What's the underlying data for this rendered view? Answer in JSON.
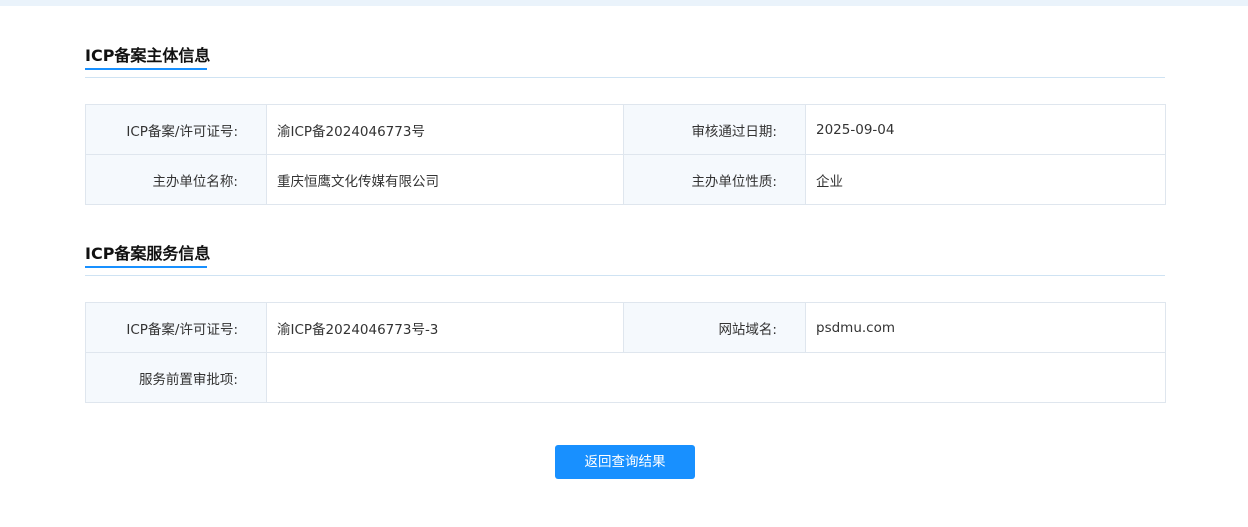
{
  "subject_section": {
    "title": "ICP备案主体信息",
    "rows": [
      {
        "label1": "ICP备案/许可证号:",
        "value1": "渝ICP备2024046773号",
        "label2": "审核通过日期:",
        "value2": "2025-09-04"
      },
      {
        "label1": "主办单位名称:",
        "value1": "重庆恒鹰文化传媒有限公司",
        "label2": "主办单位性质:",
        "value2": "企业"
      }
    ]
  },
  "service_section": {
    "title": "ICP备案服务信息",
    "rows": [
      {
        "label1": "ICP备案/许可证号:",
        "value1": "渝ICP备2024046773号-3",
        "label2": "网站域名:",
        "value2": "psdmu.com"
      },
      {
        "label1": "服务前置审批项:",
        "value1": ""
      }
    ]
  },
  "actions": {
    "back_label": "返回查询结果"
  },
  "colors": {
    "accent": "#1890ff",
    "label_bg": "#f5f9fd",
    "border": "#dfe6ee",
    "top_bar": "#eaf3fb"
  }
}
